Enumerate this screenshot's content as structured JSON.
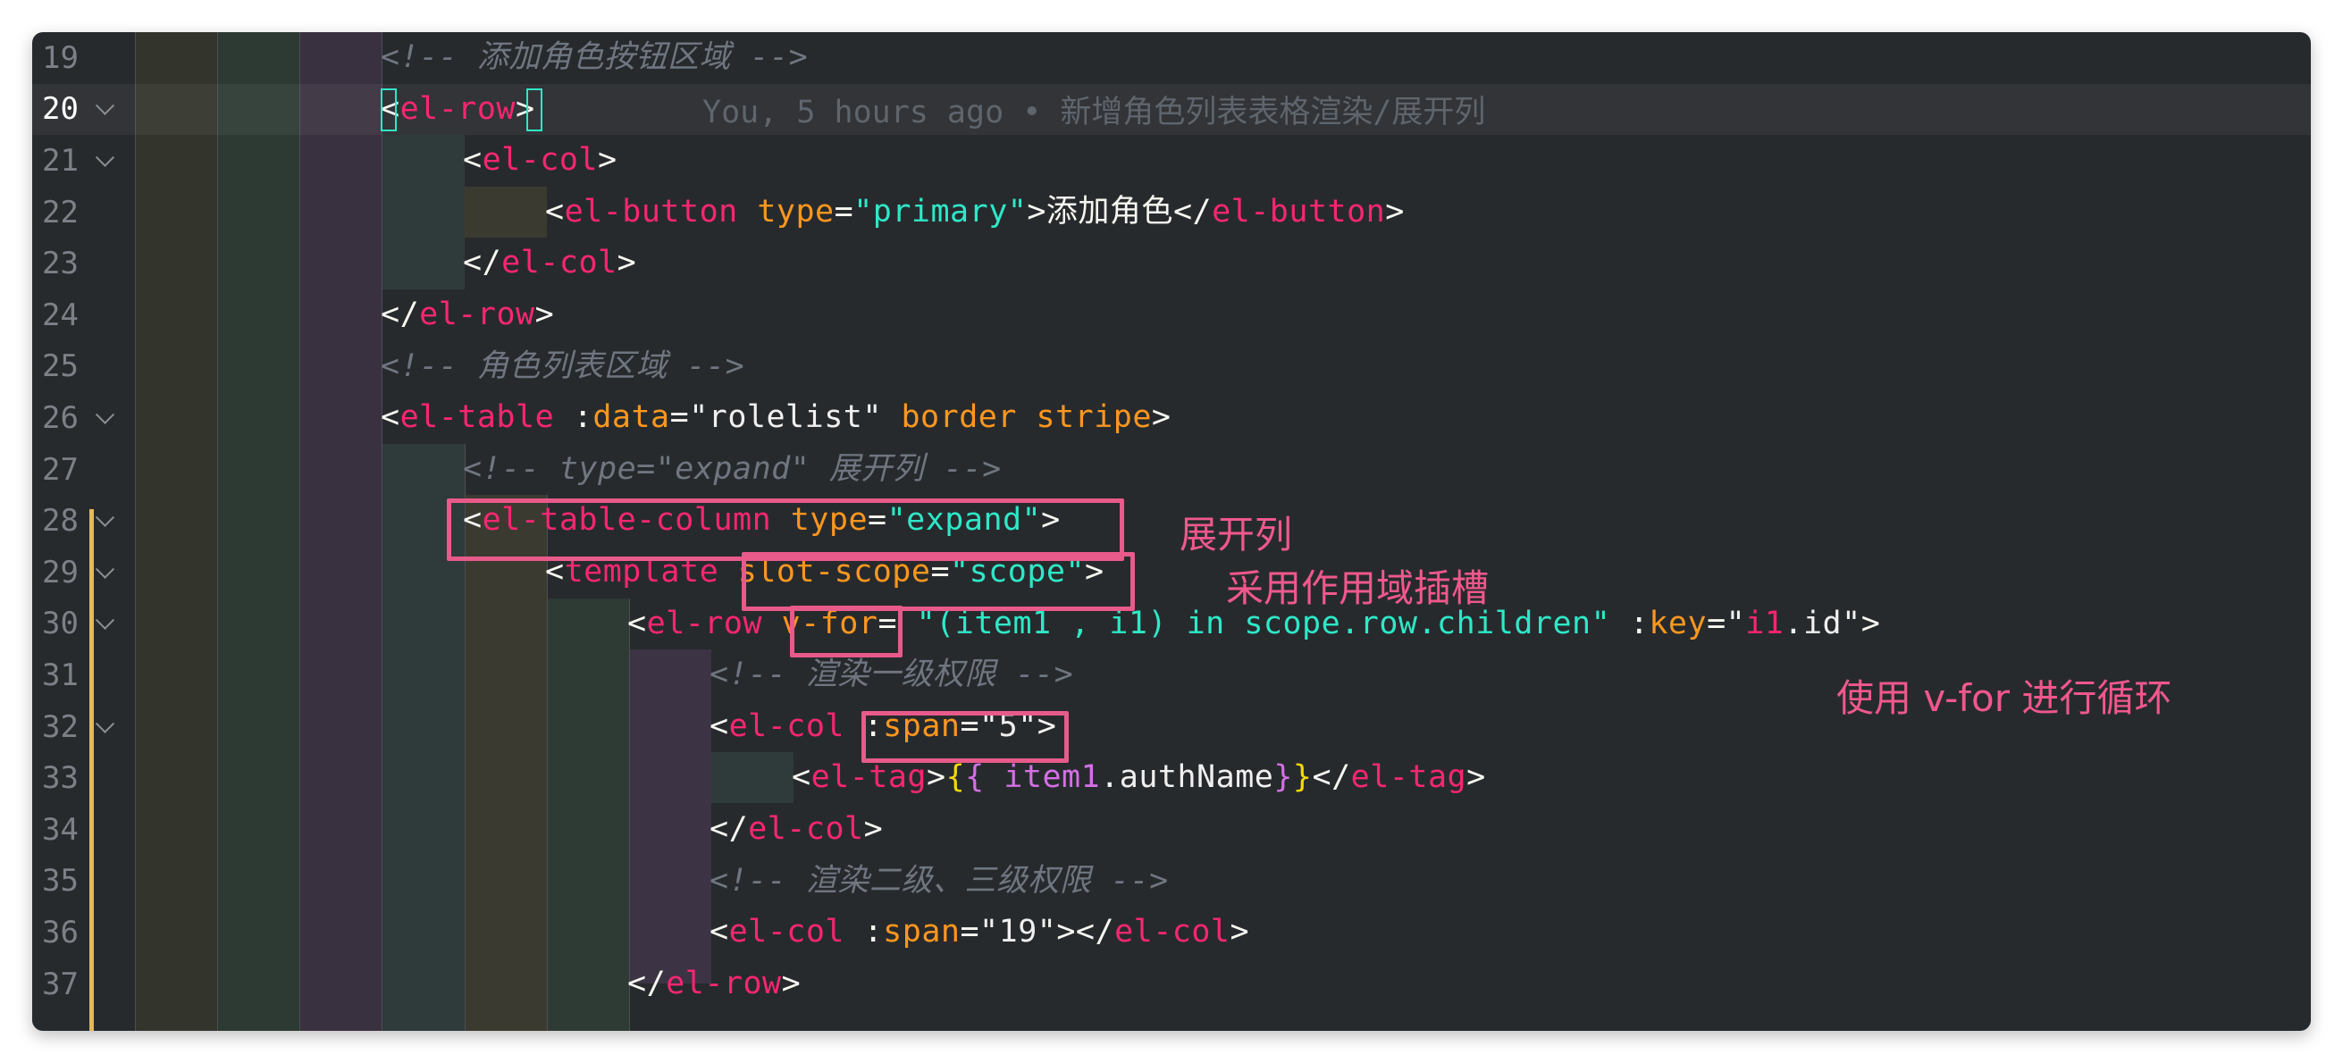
{
  "editor": {
    "active_line": 20,
    "blame": "You, 5 hours ago • 新增角色列表表格渲染/展开列",
    "lines": [
      {
        "num": "19",
        "fold": false
      },
      {
        "num": "20",
        "fold": true
      },
      {
        "num": "21",
        "fold": true
      },
      {
        "num": "22",
        "fold": false
      },
      {
        "num": "23",
        "fold": false
      },
      {
        "num": "24",
        "fold": false
      },
      {
        "num": "25",
        "fold": false
      },
      {
        "num": "26",
        "fold": true
      },
      {
        "num": "27",
        "fold": false
      },
      {
        "num": "28",
        "fold": true
      },
      {
        "num": "29",
        "fold": true
      },
      {
        "num": "30",
        "fold": true
      },
      {
        "num": "31",
        "fold": false
      },
      {
        "num": "32",
        "fold": true
      },
      {
        "num": "33",
        "fold": false
      },
      {
        "num": "34",
        "fold": false
      },
      {
        "num": "35",
        "fold": false
      },
      {
        "num": "36",
        "fold": false
      },
      {
        "num": "37",
        "fold": false
      }
    ],
    "code": {
      "l19": "<!-- 添加角色按钮区域 -->",
      "l20_open": "<",
      "l20_tag": "el-row",
      "l20_close": ">",
      "l21_open": "<",
      "l21_tag": "el-col",
      "l21_close": ">",
      "l22_open": "<",
      "l22_tag": "el-button",
      "l22_attr": "type",
      "l22_eq": "=",
      "l22_val": "\"primary\"",
      "l22_gt": ">",
      "l22_text": "添加角色",
      "l22_end_open": "</",
      "l22_end_tag": "el-button",
      "l22_end_close": ">",
      "l23_open": "</",
      "l23_tag": "el-col",
      "l23_close": ">",
      "l24_open": "</",
      "l24_tag": "el-row",
      "l24_close": ">",
      "l25": "<!-- 角色列表区域 -->",
      "l26_open": "<",
      "l26_tag": "el-table",
      "l26_attr1_colon": " :",
      "l26_attr1": "data",
      "l26_eq": "=",
      "l26_val": "\"rolelist\"",
      "l26_attr2": " border stripe",
      "l26_close": ">",
      "l27": "<!-- type=\"expand\" 展开列 -->",
      "l28_open": "<",
      "l28_tag": "el-table-column",
      "l28_attr": " type",
      "l28_eq": "=",
      "l28_val": "\"expand\"",
      "l28_close": ">",
      "l29_open": "<",
      "l29_tag": "template",
      "l29_attr": " slot-scope",
      "l29_eq": "=",
      "l29_val": "\"scope\"",
      "l29_close": ">",
      "l30_open": "<",
      "l30_tag": "el-row",
      "l30_attr": " v-for",
      "l30_eq": "= ",
      "l30_val": "\"(item1 , i1) in scope.row.children\"",
      "l30_colon": " :",
      "l30_attr2": "key",
      "l30_eq2": "=",
      "l30_q1": "\"",
      "l30_val2a": "i1",
      "l30_val2b": ".id",
      "l30_q2": "\"",
      "l30_close": ">",
      "l31": "<!-- 渲染一级权限 -->",
      "l32_open": "<",
      "l32_tag": "el-col",
      "l32_colon": " :",
      "l32_attr": "span",
      "l32_eq": "=",
      "l32_val": "\"5\"",
      "l32_close": ">",
      "l33_open": "<",
      "l33_tag": "el-tag",
      "l33_gt": ">",
      "l33_b1": "{",
      "l33_b2": "{",
      "l33_expr_a": " item1",
      "l33_expr_b": ".authName",
      "l33_b3": "}",
      "l33_b4": "}",
      "l33_end_open": "</",
      "l33_end_tag": "el-tag",
      "l33_end_close": ">",
      "l34_open": "</",
      "l34_tag": "el-col",
      "l34_close": ">",
      "l35": "<!-- 渲染二级、三级权限 -->",
      "l36_open": "<",
      "l36_tag": "el-col",
      "l36_colon": " :",
      "l36_attr": "span",
      "l36_eq": "=",
      "l36_val": "\"19\"",
      "l36_gt": "></",
      "l36_end_tag": "el-col",
      "l36_close": ">",
      "l37_open": "</",
      "l37_tag": "el-row",
      "l37_close": ">"
    }
  },
  "annotations": {
    "expand_col": "展开列",
    "scoped_slot": "采用作用域插槽",
    "vfor_loop": "使用 v-for 进行循环"
  },
  "colors": {
    "background": "#272a2d",
    "tag": "#f92672",
    "attr": "#fd971f",
    "string": "#2ee8c8",
    "comment": "#6f7680",
    "annotation": "#e85a8a",
    "git_bar": "#e6b85c"
  }
}
